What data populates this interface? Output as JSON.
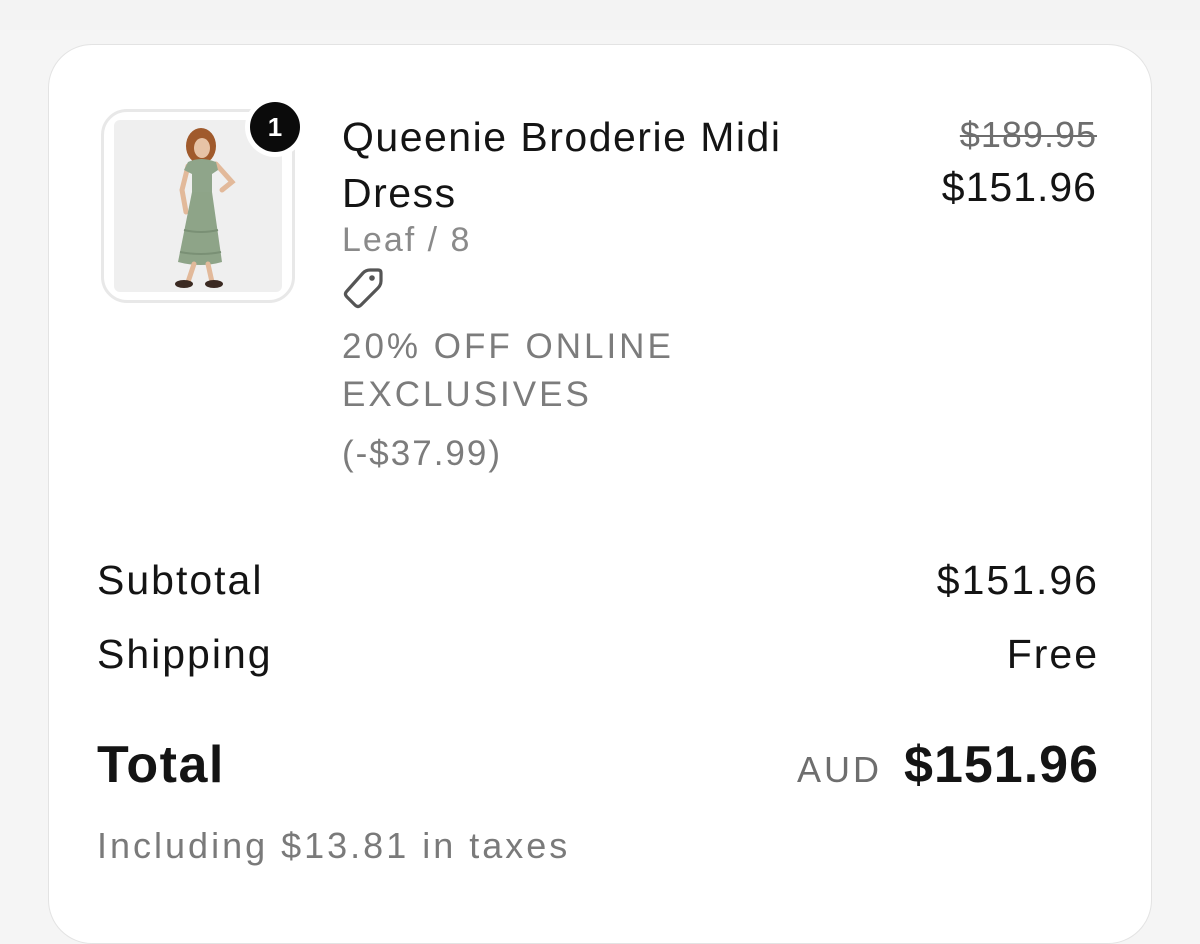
{
  "order_summary": {
    "line_items": [
      {
        "quantity": "1",
        "name": "Queenie Broderie Midi Dress",
        "variant": "Leaf / 8",
        "discount_name": "20% OFF ONLINE EXCLUSIVES",
        "discount_amount": "(-$37.99)",
        "original_price": "$189.95",
        "price": "$151.96",
        "thumbnail_icon": "product-photo-dress"
      }
    ],
    "subtotal": {
      "label": "Subtotal",
      "value": "$151.96"
    },
    "shipping": {
      "label": "Shipping",
      "value": "Free"
    },
    "total": {
      "label": "Total",
      "currency": "AUD",
      "value": "$151.96"
    },
    "tax_note": "Including $13.81 in taxes"
  },
  "colors": {
    "text": "#141414",
    "muted": "#7c7c7c",
    "badge": "#0b0b0b",
    "card": "#ffffff",
    "dress": "#8fa58a"
  }
}
